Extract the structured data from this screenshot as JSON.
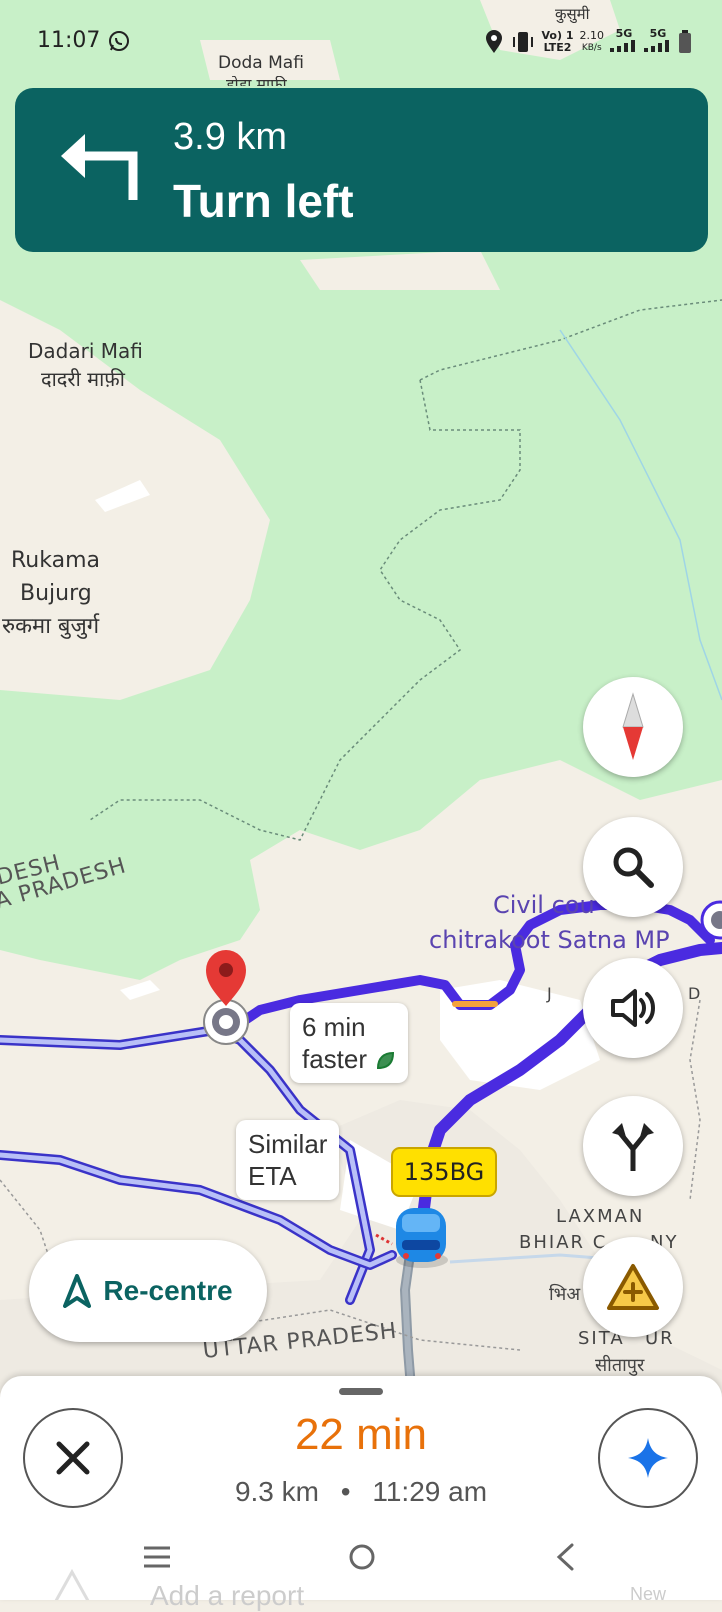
{
  "status_bar": {
    "time": "11:07",
    "network_line1": "Vo) 1",
    "network_line2": "LTE2",
    "speed_value": "2.10",
    "speed_unit": "KB/s",
    "net_a": "5G",
    "net_b": "5G"
  },
  "navigation": {
    "distance": "3.9 km",
    "instruction": "Turn left",
    "maneuver_icon": "turn-left-arrow-icon"
  },
  "map_labels": {
    "kusumi": "कुसुमी",
    "doda_mafi": "Doda Mafi",
    "doda_mafi_hi": "डोडा माफ़ी",
    "dadari_mafi": "Dadari Mafi",
    "dadari_mafi_hi": "दादरी माफ़ी",
    "rukama_1": "Rukama",
    "rukama_2": "Bujurg",
    "rukama_hi": "रुकमा बुजुर्ग",
    "state_1": "DESH",
    "state_2": "A PRADESH",
    "civil_court_1": "Civil cou",
    "civil_court_2": "chitrakoot Satna MP",
    "j_label": "J",
    "d_label": "D",
    "laxman_1": "LAXMAN",
    "laxman_2": "BHIAR C",
    "laxman_3": "NY",
    "bhia_hi": "भिअ",
    "sitapur": "SITA",
    "sitapur_2": "UR",
    "sitapur_hi": "सीतापुर",
    "uttar_pradesh": "UTTAR PRADESH"
  },
  "route_bubbles": {
    "alt1_line1": "6 min",
    "alt1_line2": "faster",
    "alt2_line1": "Similar",
    "alt2_line2": "ETA"
  },
  "road_shield": "135BG",
  "recentre_label": "Re-centre",
  "trip": {
    "eta": "22 min",
    "distance": "9.3 km",
    "separator": "•",
    "arrival": "11:29 am"
  },
  "under_sheet": {
    "add_report": "Add a report",
    "new_badge": "New"
  },
  "colors": {
    "nav_card": "#0b6361",
    "route": "#4a2be0",
    "alt_route": "#9fa9f5",
    "eta": "#e8710a",
    "park": "#c8f0c8"
  }
}
